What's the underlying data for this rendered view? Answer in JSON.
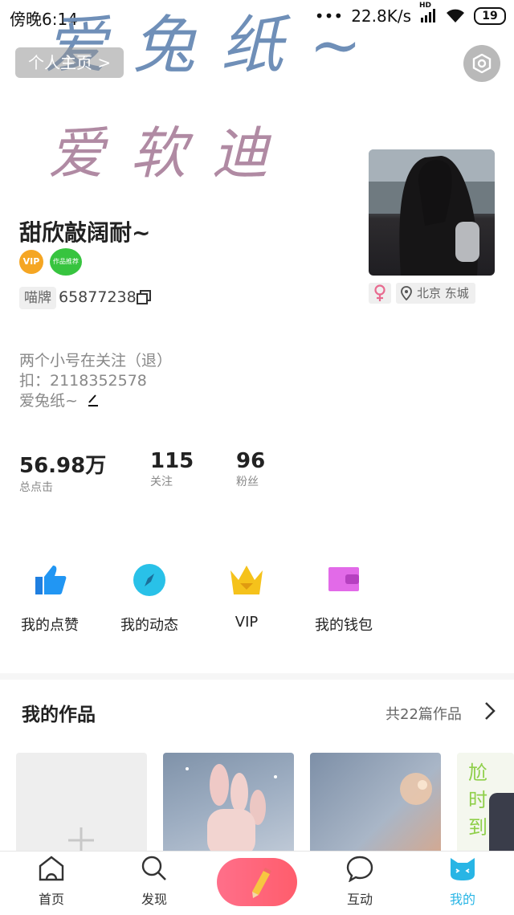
{
  "status_bar": {
    "time": "傍晚6:14",
    "network_speed": "22.8K/s",
    "signal_tag": "HD",
    "battery": "19"
  },
  "header": {
    "handwriting_line1": "爱兔纸~",
    "handwriting_line2": "爱软迪",
    "profile_link": "个人主页 >"
  },
  "user": {
    "name": "甜欣敲阔耐~",
    "badge_vip": "VIP",
    "badge_green": "作品推荐",
    "id_label": "喵牌",
    "id_number": "65877238",
    "gender_icon": "female-icon",
    "location": "北京 东城",
    "bio": [
      "两个小号在关注（退）",
      "扣：2118352578",
      "爱兔纸~"
    ]
  },
  "stats": [
    {
      "value": "56.98万",
      "label": "总点击"
    },
    {
      "value": "115",
      "label": "关注"
    },
    {
      "value": "96",
      "label": "粉丝"
    }
  ],
  "quick_actions": [
    {
      "label": "我的点赞",
      "icon": "thumbs-up-icon"
    },
    {
      "label": "我的动态",
      "icon": "compass-icon"
    },
    {
      "label": "VIP",
      "icon": "crown-icon"
    },
    {
      "label": "我的钱包",
      "icon": "wallet-icon"
    }
  ],
  "works": {
    "title": "我的作品",
    "count": "共22篇作品",
    "thumb4_text": "尬时到"
  },
  "nav": [
    {
      "label": "首页",
      "icon": "home-icon"
    },
    {
      "label": "发现",
      "icon": "search-icon"
    },
    {
      "label": "",
      "icon": "pencil-icon"
    },
    {
      "label": "互动",
      "icon": "chat-icon"
    },
    {
      "label": "我的",
      "icon": "cat-face-icon"
    }
  ],
  "colors": {
    "accent": "#28b5e5",
    "pen_button": "#ff6480",
    "vip": "#f5a623"
  }
}
